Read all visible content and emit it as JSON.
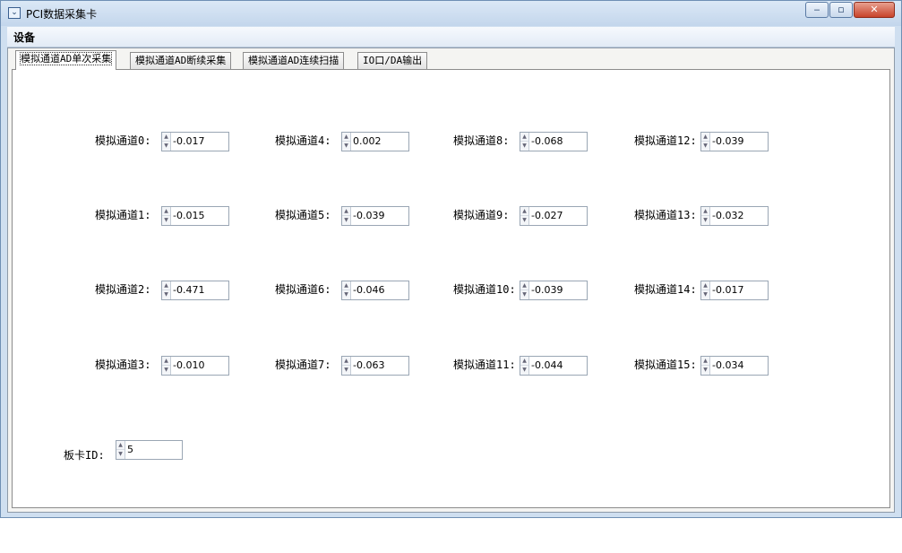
{
  "window": {
    "title": "PCI数据采集卡"
  },
  "menu": {
    "items": [
      "设备"
    ]
  },
  "tabs": [
    "模拟通道AD单次采集",
    "模拟通道AD断续采集",
    "模拟通道AD连续扫描",
    "IO口/DA输出"
  ],
  "channels": [
    {
      "label": "模拟通道0:",
      "value": "-0.017"
    },
    {
      "label": "模拟通道1:",
      "value": "-0.015"
    },
    {
      "label": "模拟通道2:",
      "value": "-0.471"
    },
    {
      "label": "模拟通道3:",
      "value": "-0.010"
    },
    {
      "label": "模拟通道4:",
      "value": "0.002"
    },
    {
      "label": "模拟通道5:",
      "value": "-0.039"
    },
    {
      "label": "模拟通道6:",
      "value": "-0.046"
    },
    {
      "label": "模拟通道7:",
      "value": "-0.063"
    },
    {
      "label": "模拟通道8:",
      "value": "-0.068"
    },
    {
      "label": "模拟通道9:",
      "value": "-0.027"
    },
    {
      "label": "模拟通道10:",
      "value": "-0.039"
    },
    {
      "label": "模拟通道11:",
      "value": "-0.044"
    },
    {
      "label": "模拟通道12:",
      "value": "-0.039"
    },
    {
      "label": "模拟通道13:",
      "value": "-0.032"
    },
    {
      "label": "模拟通道14:",
      "value": "-0.017"
    },
    {
      "label": "模拟通道15:",
      "value": "-0.034"
    }
  ],
  "board": {
    "label": "板卡ID:",
    "value": "5"
  }
}
